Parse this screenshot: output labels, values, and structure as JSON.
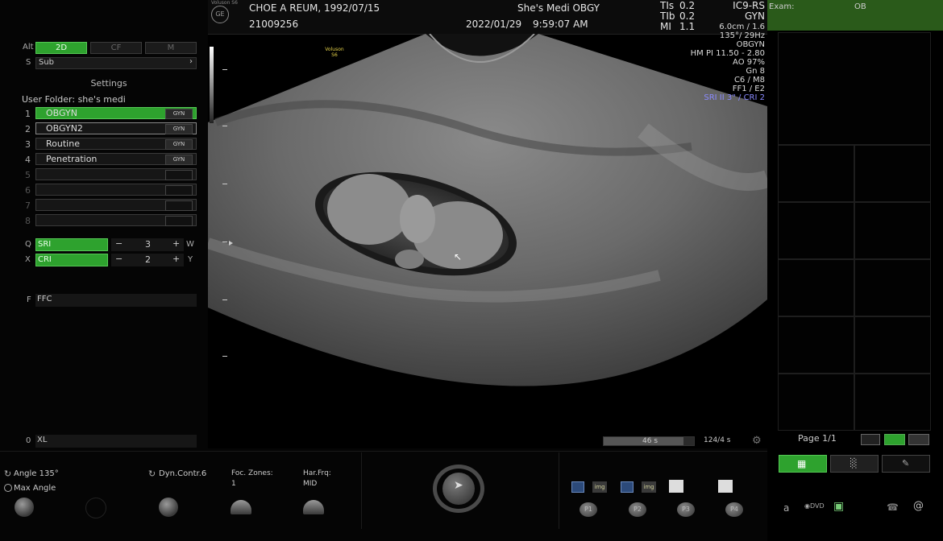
{
  "header": {
    "logo": "Voluson S6",
    "patient_name": "CHOE A REUM,",
    "dob": "1992/07/15",
    "patient_id": "21009256",
    "clinic": "She's Medi OBGY",
    "date": "2022/01/29",
    "time": "9:59:07 AM",
    "tis_label": "TIs",
    "tis_value": "0.2",
    "tib_label": "TIb",
    "tib_value": "0.2",
    "mi_label": "MI",
    "mi_value": "1.1",
    "probe": "IC9-RS",
    "app": "GYN"
  },
  "image_info": {
    "lines": [
      "6.0cm / 1.6",
      "135°/ 29Hz",
      "OBGYN",
      "HM PI 11.50 - 2.80",
      "AO 97%",
      "Gn 8",
      "C6 / M8",
      "FF1 / E2"
    ],
    "sri_line": "SRI II 3\" / CRI 2",
    "small_logo": "Voluson S6"
  },
  "left_panel": {
    "alt_label": "Alt",
    "modes": [
      "2D",
      "CF",
      "M"
    ],
    "s_label": "S",
    "sub_label": "Sub",
    "settings_title": "Settings",
    "user_folder": "User Folder: she's medi",
    "presets": [
      {
        "num": "1",
        "label": "OBGYN",
        "tag": "GYN"
      },
      {
        "num": "2",
        "label": "OBGYN2",
        "tag": "GYN"
      },
      {
        "num": "3",
        "label": "Routine",
        "tag": "GYN"
      },
      {
        "num": "4",
        "label": "Penetration",
        "tag": "GYN"
      },
      {
        "num": "5",
        "label": "",
        "tag": ""
      },
      {
        "num": "6",
        "label": "",
        "tag": ""
      },
      {
        "num": "7",
        "label": "",
        "tag": ""
      },
      {
        "num": "8",
        "label": "",
        "tag": ""
      }
    ],
    "q_label": "Q",
    "sri_label": "SRI",
    "sri_value": "3",
    "w_label": "W",
    "x_label": "X",
    "cri_label": "CRI",
    "cri_value": "2",
    "y_label": "Y",
    "minus": "−",
    "plus": "+",
    "f_label": "F",
    "ffc_label": "FFC",
    "o_label": "0",
    "xl_label": "XL"
  },
  "right_panel": {
    "exam_label": "Exam:",
    "exam_value": "OB",
    "page_label": "Page 1/1"
  },
  "cine": {
    "progress_label": "46 s",
    "progress_fraction": 0.88,
    "count_label": "124/4 s"
  },
  "bottom": {
    "angle_label": "Angle 135°",
    "max_angle_label": "Max Angle",
    "dyn_label": "Dyn.Contr.6",
    "foc_label": "Foc. Zones:",
    "foc_value": "1",
    "har_label": "Har.Frq:",
    "har_value": "MID",
    "p_buttons": [
      "P1",
      "P2",
      "P3",
      "P4"
    ],
    "img_label": "img",
    "a_label": "a",
    "dvd_label": "DVD"
  }
}
